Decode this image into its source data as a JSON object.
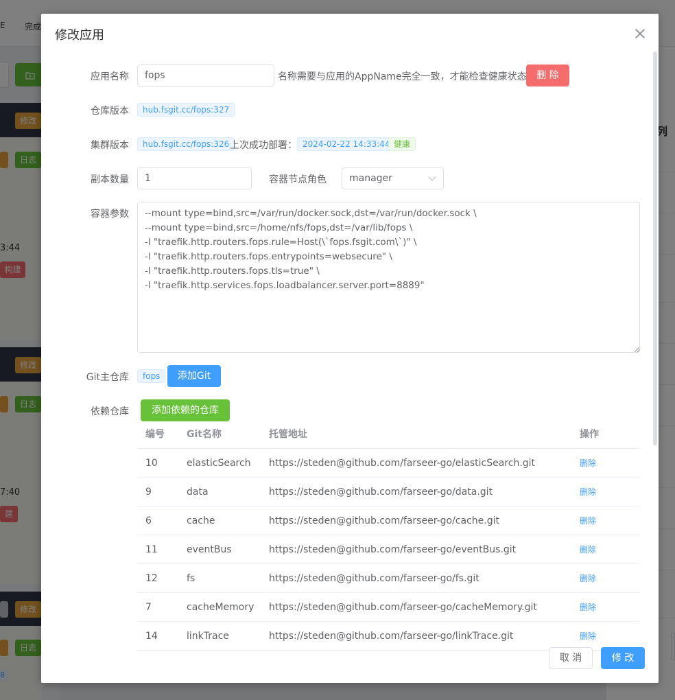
{
  "background": {
    "tabs": [
      "完成"
    ],
    "cards": [
      {
        "edit": "修改",
        "log": "日志",
        "time": "3:44",
        "rebuild": "构建"
      },
      {
        "edit": "修改",
        "log": "日志",
        "time": "7:40",
        "rebuild": "建"
      },
      {
        "edit": "修改",
        "log": "日志",
        "tag": "8"
      }
    ],
    "right_title": "列"
  },
  "dialog": {
    "title": "修改应用",
    "fields": {
      "app_name_label": "应用名称",
      "app_name_value": "fops",
      "app_name_hint": "名称需要与应用的AppName完全一致，才能检查健康状态",
      "delete_label": "删 除",
      "repo_version_label": "仓库版本",
      "repo_version_tag": "hub.fsgit.cc/fops:327",
      "cluster_version_label": "集群版本",
      "cluster_version_tag": "hub.fsgit.cc/fops:326",
      "last_deploy_label": "上次成功部署：",
      "last_deploy_time": "2024-02-22 14:33:44",
      "health_tag": "健康",
      "replicas_label": "副本数量",
      "replicas_value": "1",
      "node_role_label": "容器节点角色",
      "node_role_value": "manager",
      "container_args_label": "容器参数",
      "container_args": "--mount type=bind,src=/var/run/docker.sock,dst=/var/run/docker.sock \\\n--mount type=bind,src=/home/nfs/fops,dst=/var/lib/fops \\\n-l \"traefik.http.routers.fops.rule=Host(\\`fops.fsgit.com\\`)\" \\\n-l \"traefik.http.routers.fops.entrypoints=websecure\" \\\n-l \"traefik.http.routers.fops.tls=true\" \\\n-l \"traefik.http.services.fops.loadbalancer.server.port=8889\"",
      "git_main_label": "Git主仓库",
      "git_main_tag": "fops",
      "add_git_label": "添加Git",
      "deps_label": "依赖仓库",
      "add_dep_label": "添加依赖的仓库"
    },
    "table": {
      "headers": [
        "编号",
        "Git名称",
        "托管地址",
        "操作"
      ],
      "rows": [
        {
          "id": "10",
          "name": "elasticSearch",
          "url": "https://steden@github.com/farseer-go/elasticSearch.git",
          "action": "删除"
        },
        {
          "id": "9",
          "name": "data",
          "url": "https://steden@github.com/farseer-go/data.git",
          "action": "删除"
        },
        {
          "id": "6",
          "name": "cache",
          "url": "https://steden@github.com/farseer-go/cache.git",
          "action": "删除"
        },
        {
          "id": "11",
          "name": "eventBus",
          "url": "https://steden@github.com/farseer-go/eventBus.git",
          "action": "删除"
        },
        {
          "id": "12",
          "name": "fs",
          "url": "https://steden@github.com/farseer-go/fs.git",
          "action": "删除"
        },
        {
          "id": "7",
          "name": "cacheMemory",
          "url": "https://steden@github.com/farseer-go/cacheMemory.git",
          "action": "删除"
        },
        {
          "id": "14",
          "name": "linkTrace",
          "url": "https://steden@github.com/farseer-go/linkTrace.git",
          "action": "删除"
        }
      ]
    },
    "footer": {
      "cancel_label": "取 消",
      "confirm_label": "修 改"
    }
  }
}
